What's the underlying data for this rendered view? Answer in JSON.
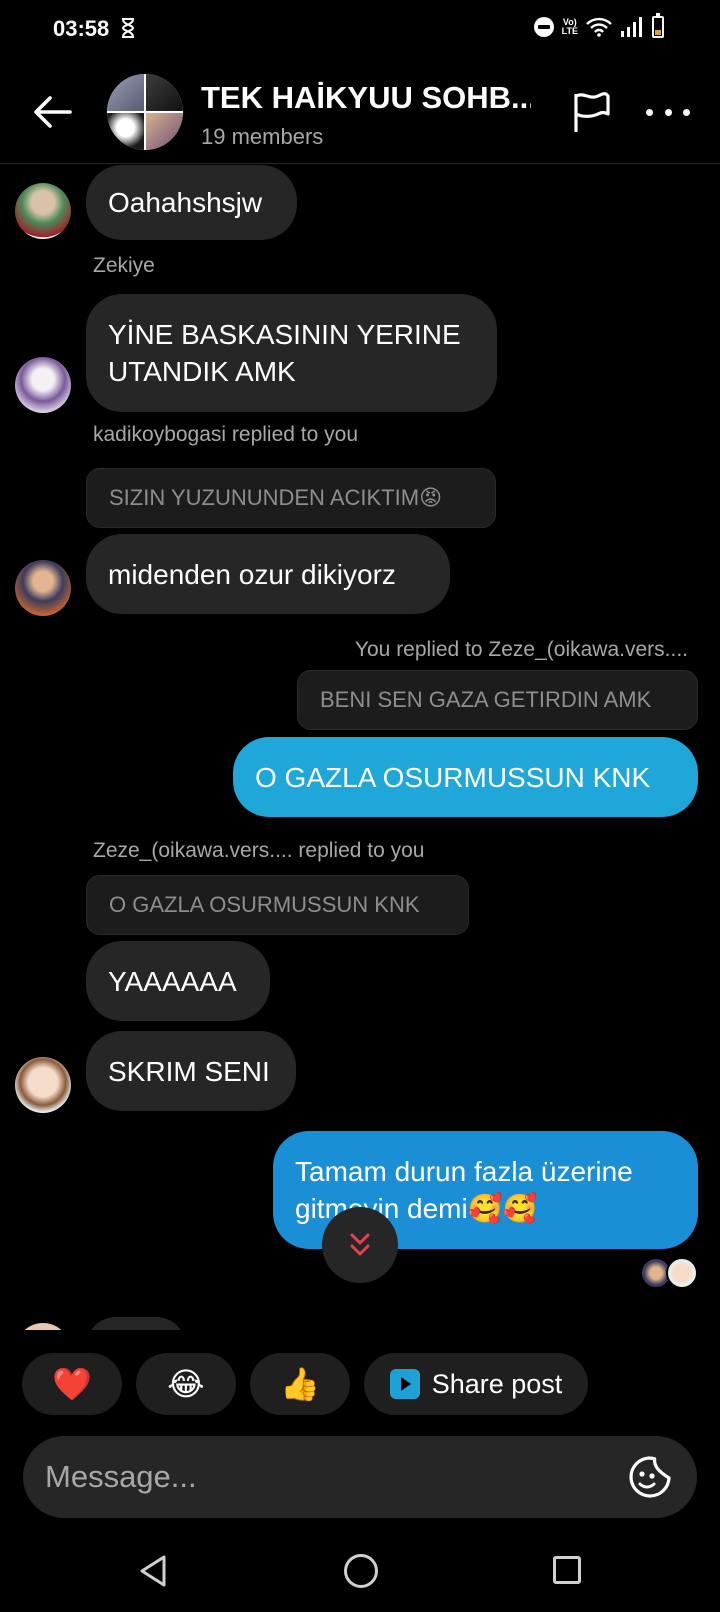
{
  "status_bar": {
    "time": "03:58",
    "volte_top": "Vo)",
    "volte_bottom": "LTE"
  },
  "header": {
    "title": "TEK HAİKYUU SOHB...",
    "subtitle": "19 members",
    "back_icon": "arrow-left-icon",
    "flag_icon": "flag-icon",
    "more_icon": "more-horizontal-icon"
  },
  "messages": [
    {
      "text": "Oahahshsjw"
    },
    {
      "sender": "Zekiye",
      "line1": "YİNE BASKASININ YERINE",
      "line2": "UTANDIK AMK"
    },
    {
      "reply_meta": "kadikoybogasi replied to you",
      "quote": "SIZIN YUZUNUNDEN ACIKTIM😡",
      "text": "midenden ozur dikiyorz"
    },
    {
      "reply_meta": "You replied to Zeze_(oikawa.vers....",
      "quote": "BENI SEN GAZA GETIRDIN AMK",
      "text": "O GAZLA OSURMUSSUN KNK"
    },
    {
      "reply_meta": "Zeze_(oikawa.vers.... replied to you",
      "quote": "O GAZLA OSURMUSSUN KNK",
      "text1": "YAAAAAA",
      "text2": "SKRIM SENI"
    },
    {
      "line1": "Tamam durun fazla üzerine",
      "line2": "gitmeyin demi🥰🥰"
    }
  ],
  "quick_replies": {
    "heart": "❤️",
    "laugh": "😂",
    "thumbs_up": "👍",
    "share_post": "Share post"
  },
  "composer": {
    "placeholder": "Message..."
  },
  "colors": {
    "background": "#000000",
    "incoming_bubble": "#262626",
    "outgoing_bubble": "#1da1d6",
    "muted_text": "#a8a8a8"
  }
}
